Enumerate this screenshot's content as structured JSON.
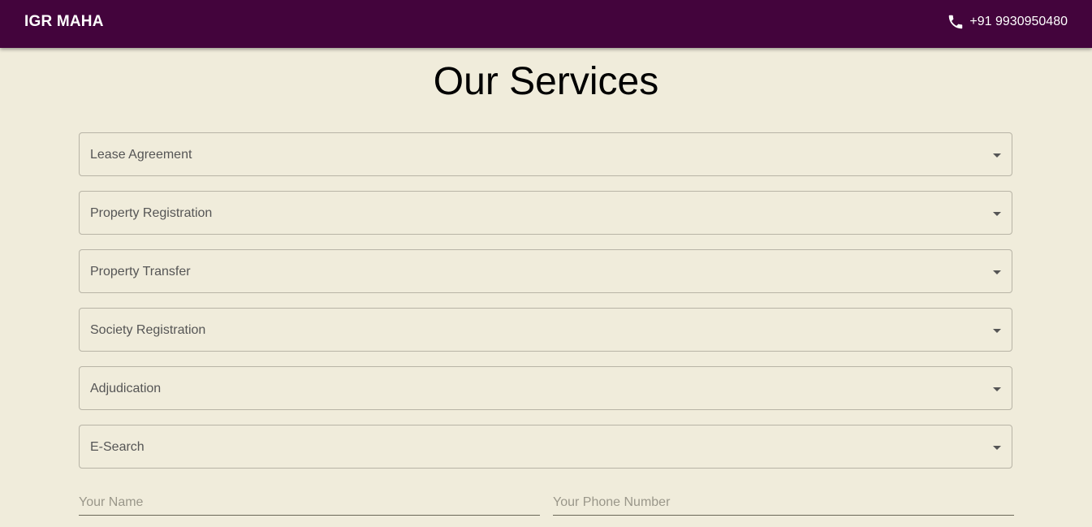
{
  "header": {
    "brand": "IGR MAHA",
    "phone_icon": "phone-icon",
    "phone": "+91 9930950480",
    "background": "#43043c"
  },
  "main": {
    "title": "Our Services",
    "services": [
      {
        "label": "Lease Agreement"
      },
      {
        "label": "Property Registration"
      },
      {
        "label": "Property Transfer"
      },
      {
        "label": "Society Registration"
      },
      {
        "label": "Adjudication"
      },
      {
        "label": "E-Search"
      }
    ],
    "form": {
      "name_placeholder": "Your Name",
      "phone_placeholder": "Your Phone Number"
    }
  }
}
